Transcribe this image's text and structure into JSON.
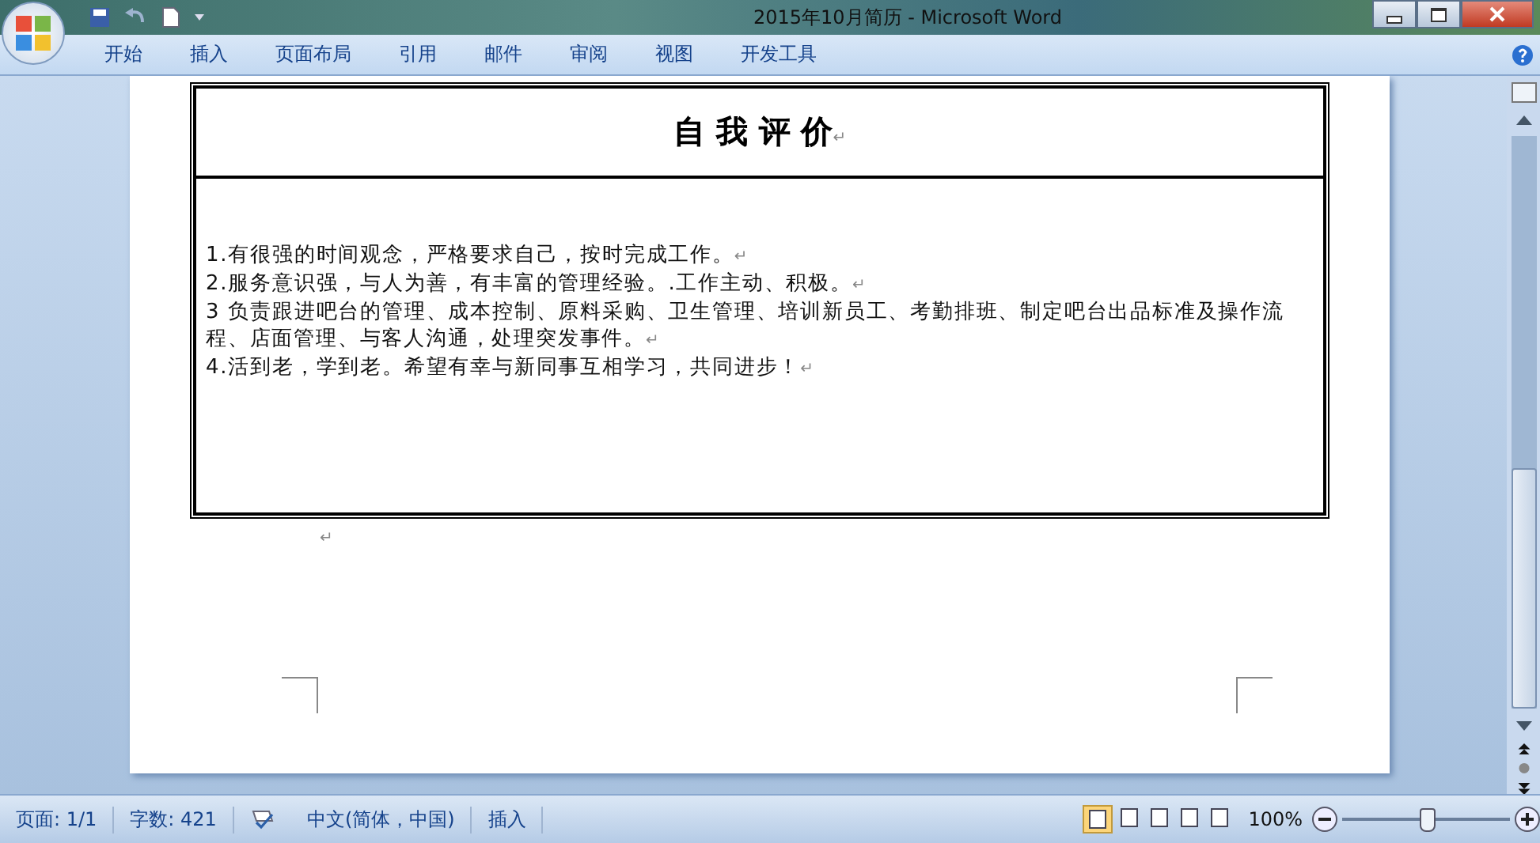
{
  "window": {
    "title": "2015年10月简历 - Microsoft Word"
  },
  "ribbon_tabs": [
    {
      "label": "开始",
      "selected": false
    },
    {
      "label": "插入",
      "selected": false
    },
    {
      "label": "页面布局",
      "selected": false
    },
    {
      "label": "引用",
      "selected": false
    },
    {
      "label": "邮件",
      "selected": false
    },
    {
      "label": "审阅",
      "selected": false
    },
    {
      "label": "视图",
      "selected": false
    },
    {
      "label": "开发工具",
      "selected": false
    }
  ],
  "document": {
    "paragraph_mark": "↵",
    "title": "自 我 评 价",
    "lines": [
      "1.有很强的时间观念，严格要求自己，按时完成工作。",
      "2.服务意识强，与人为善，有丰富的管理经验。.工作主动、积极。",
      "3 负责跟进吧台的管理、成本控制、原料采购、卫生管理、培训新员工、考勤排班、制定吧台出品标准及操作流程、店面管理、与客人沟通，处理突发事件。",
      "4.活到老，学到老。希望有幸与新同事互相学习，共同进步！"
    ]
  },
  "status_bar": {
    "page": "页面: 1/1",
    "words": "字数: 421",
    "language": "中文(简体，中国)",
    "mode": "插入",
    "zoom": "100%",
    "views": [
      {
        "selected": true
      },
      {
        "selected": false
      },
      {
        "selected": false
      },
      {
        "selected": false
      },
      {
        "selected": false
      }
    ],
    "zoom_slider": {
      "level": 0.5
    }
  }
}
